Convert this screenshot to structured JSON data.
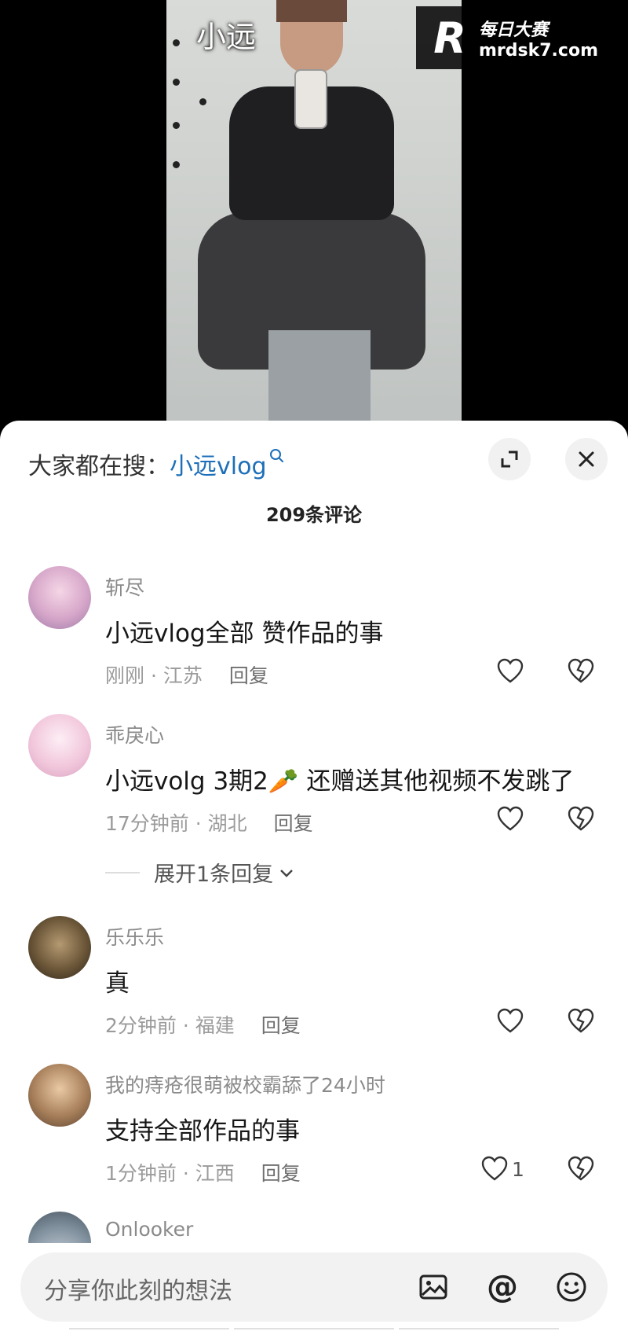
{
  "video": {
    "caption": "小远",
    "watermark": {
      "brand": "每日大赛",
      "url": "mrdsk7.com"
    }
  },
  "sheet": {
    "search_prefix": "大家都在搜：",
    "search_term": "小远vlog",
    "comment_count": "209条评论",
    "comments": [
      {
        "user": "斩尽",
        "text": "小远vlog全部 赞作品的事",
        "time": "刚刚",
        "location": "江苏",
        "reply": "回复",
        "likes": ""
      },
      {
        "user": "乖戾心",
        "text": "小远volg 3期2🥕 还赠送其他视频不发跳了",
        "time": "17分钟前",
        "location": "湖北",
        "reply": "回复",
        "likes": ""
      },
      {
        "user": "乐乐乐",
        "text": "真",
        "time": "2分钟前",
        "location": "福建",
        "reply": "回复",
        "likes": ""
      },
      {
        "user": "我的痔疮很萌被校霸舔了24小时",
        "text": "支持全部作品的事",
        "time": "1分钟前",
        "location": "江西",
        "reply": "回复",
        "likes": "1"
      },
      {
        "user": "Onlooker"
      }
    ],
    "expand_replies": "展开1条回复"
  },
  "input": {
    "placeholder": "分享你此刻的想法"
  },
  "colors": {
    "link": "#1d6fb8",
    "sheet_bg": "#ffffff",
    "muted": "#9b9b9b"
  }
}
